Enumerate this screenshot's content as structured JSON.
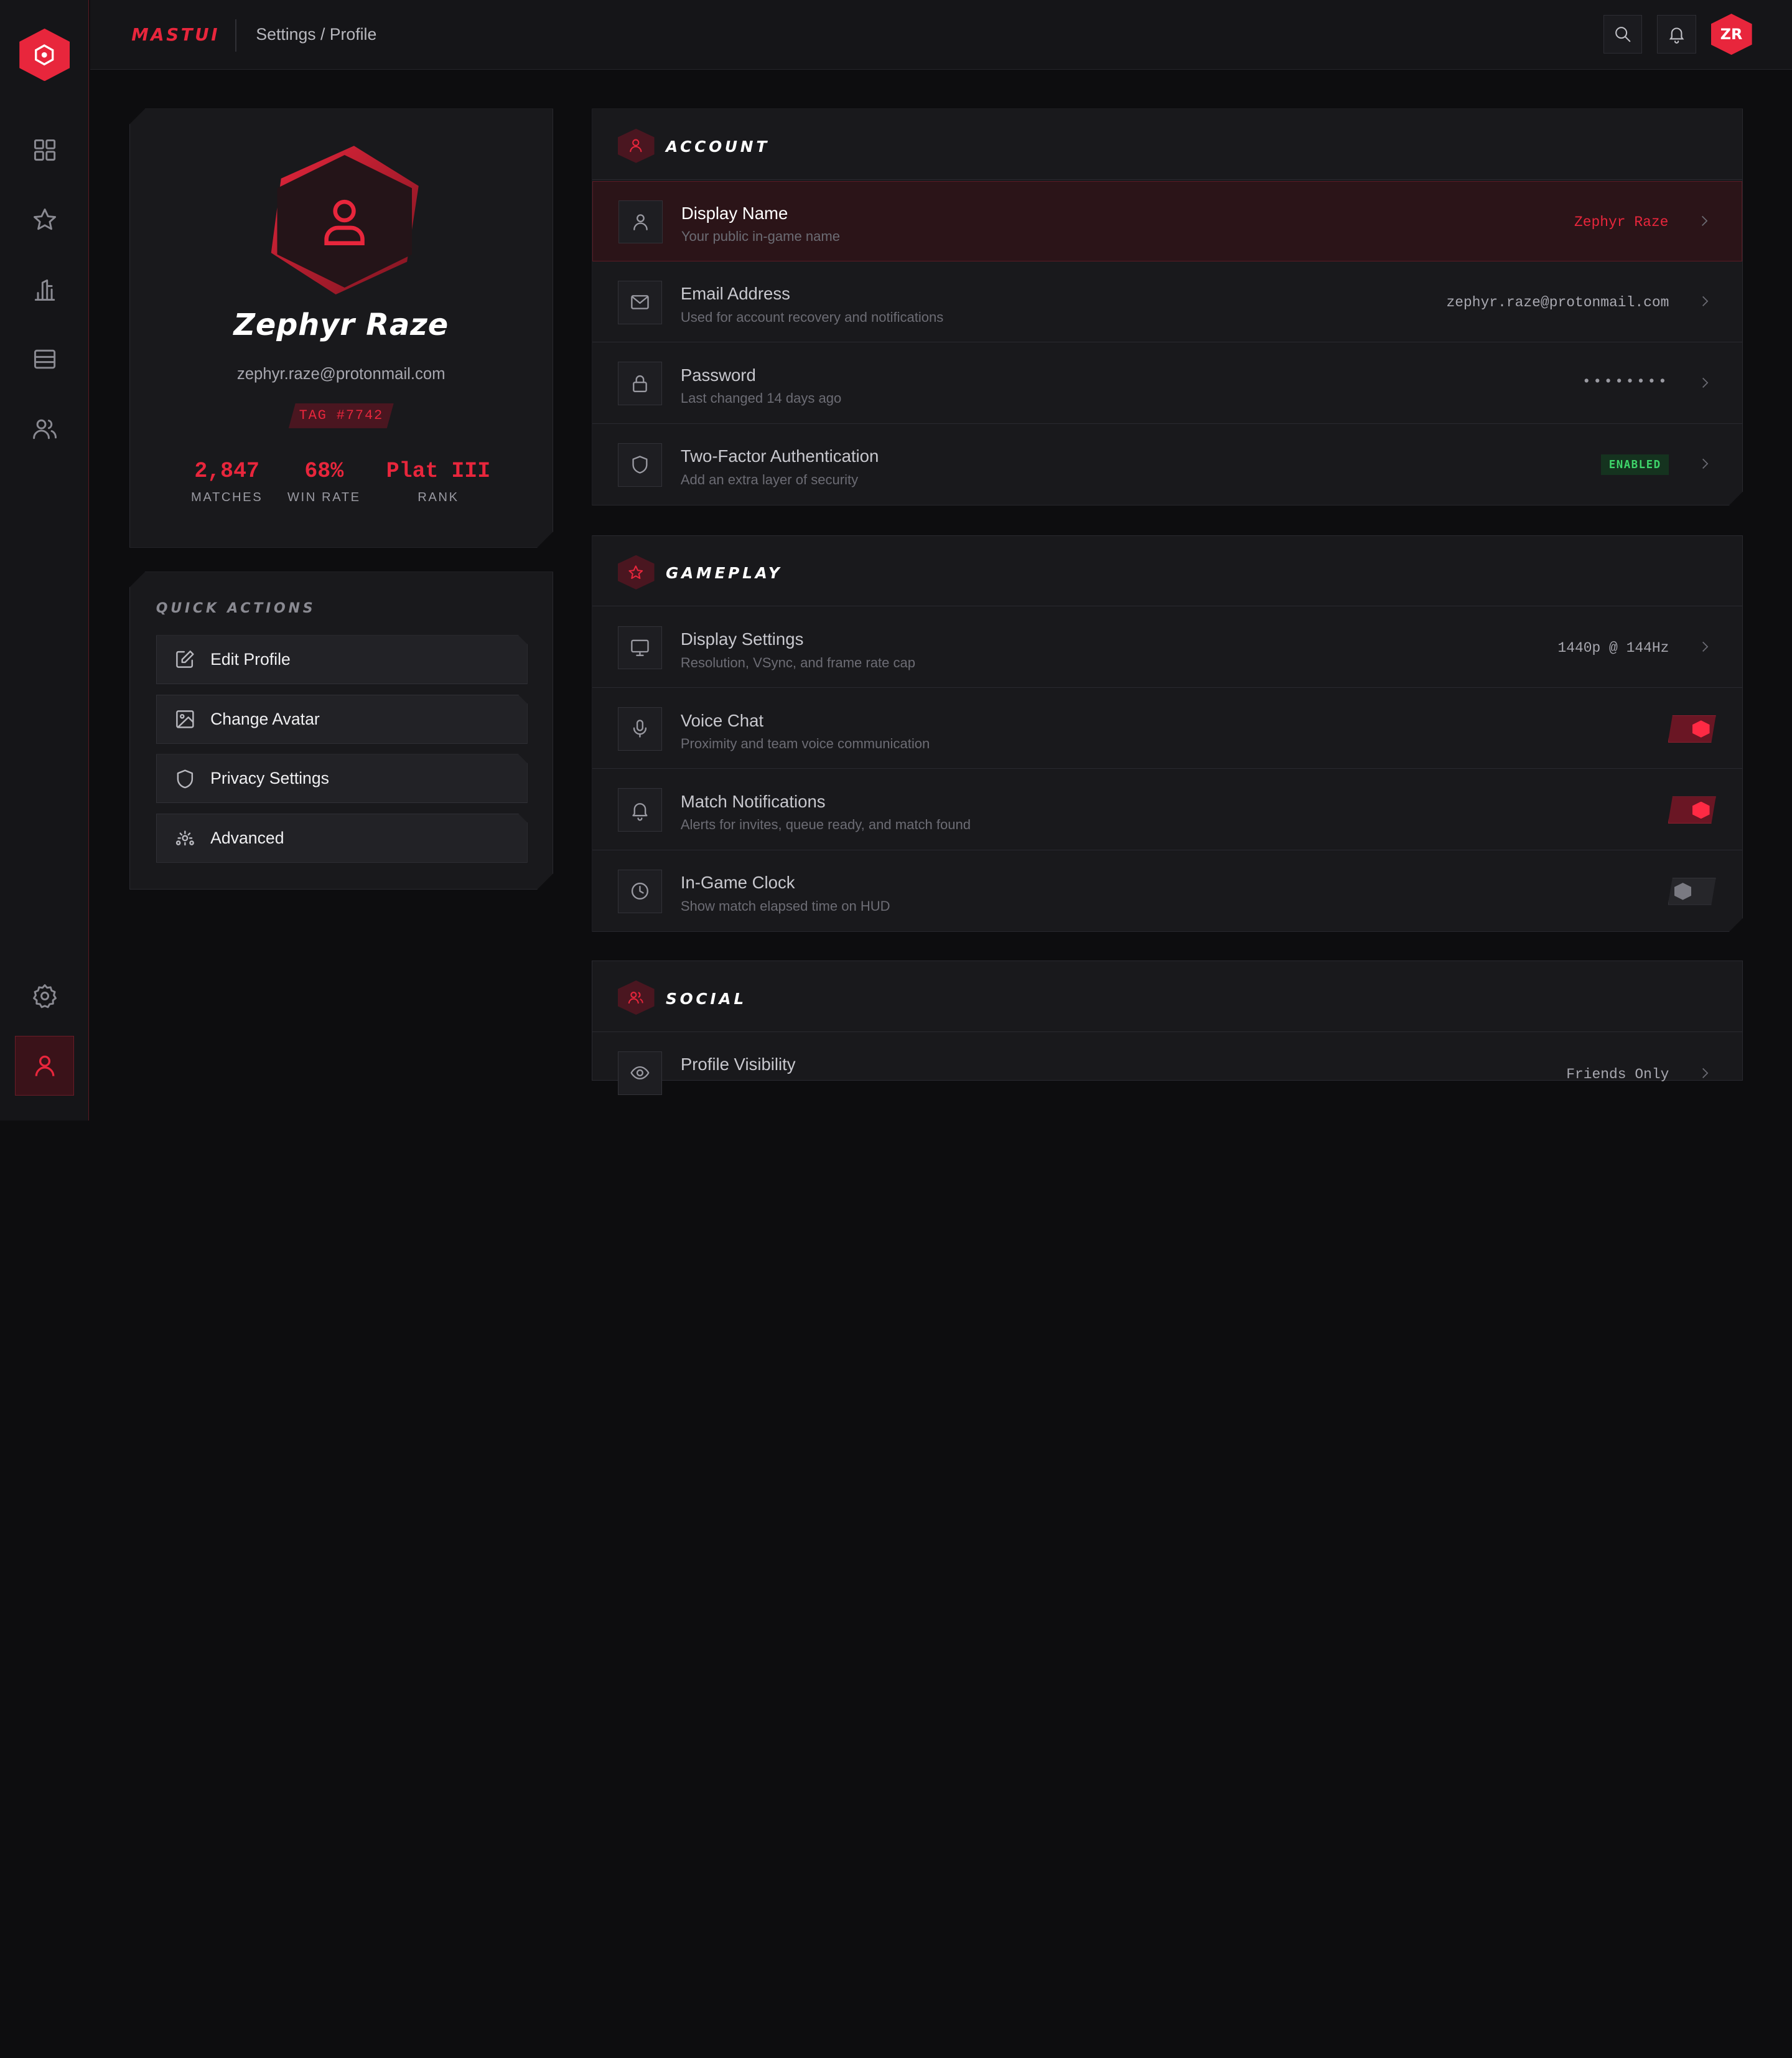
{
  "app": {
    "brand": "MASTUI",
    "breadcrumb": "Settings / Profile",
    "avatar_initials": "ZR"
  },
  "sidebar": {
    "items": [
      {
        "name": "dashboard",
        "icon": "grid-icon"
      },
      {
        "name": "favorites",
        "icon": "star-icon"
      },
      {
        "name": "leaderboard",
        "icon": "podium-icon"
      },
      {
        "name": "inventory",
        "icon": "card-icon"
      },
      {
        "name": "friends",
        "icon": "users-icon"
      },
      {
        "name": "settings",
        "icon": "gear-icon"
      },
      {
        "name": "profile",
        "icon": "user-icon",
        "active": true
      }
    ]
  },
  "profile": {
    "name": "Zephyr Raze",
    "email": "zephyr.raze@protonmail.com",
    "tag": "TAG #7742",
    "stats": [
      {
        "value": "2,847",
        "label": "MATCHES"
      },
      {
        "value": "68%",
        "label": "WIN RATE"
      },
      {
        "value": "Plat III",
        "label": "RANK"
      }
    ]
  },
  "quick_actions": {
    "title": "QUICK ACTIONS",
    "items": [
      {
        "label": "Edit Profile",
        "icon": "edit-icon"
      },
      {
        "label": "Change Avatar",
        "icon": "image-icon"
      },
      {
        "label": "Privacy Settings",
        "icon": "shield-icon"
      },
      {
        "label": "Advanced",
        "icon": "settings-icon"
      }
    ]
  },
  "sections": {
    "account": {
      "title": "ACCOUNT",
      "rows": [
        {
          "label": "Display Name",
          "sub": "Your public in-game name",
          "value": "Zephyr Raze"
        },
        {
          "label": "Email Address",
          "sub": "Used for account recovery and notifications",
          "value": "zephyr.raze@protonmail.com"
        },
        {
          "label": "Password",
          "sub": "Last changed 14 days ago",
          "value": "••••••••"
        },
        {
          "label": "Two-Factor Authentication",
          "sub": "Add an extra layer of security",
          "badge": "ENABLED"
        }
      ]
    },
    "gameplay": {
      "title": "GAMEPLAY",
      "rows": [
        {
          "label": "Display Settings",
          "sub": "Resolution, VSync, and frame rate cap",
          "value": "1440p @ 144Hz"
        },
        {
          "label": "Voice Chat",
          "sub": "Proximity and team voice communication",
          "toggle": "on"
        },
        {
          "label": "Match Notifications",
          "sub": "Alerts for invites, queue ready, and match found",
          "toggle": "on"
        },
        {
          "label": "In-Game Clock",
          "sub": "Show match elapsed time on HUD",
          "toggle": "off"
        }
      ]
    },
    "social": {
      "title": "SOCIAL",
      "rows": [
        {
          "label": "Profile Visibility",
          "value": "Friends Only"
        }
      ]
    }
  },
  "colors": {
    "accent": "#e8263c",
    "background": "#0d0d0f",
    "panel": "#19191c",
    "success": "#3ed46a"
  }
}
